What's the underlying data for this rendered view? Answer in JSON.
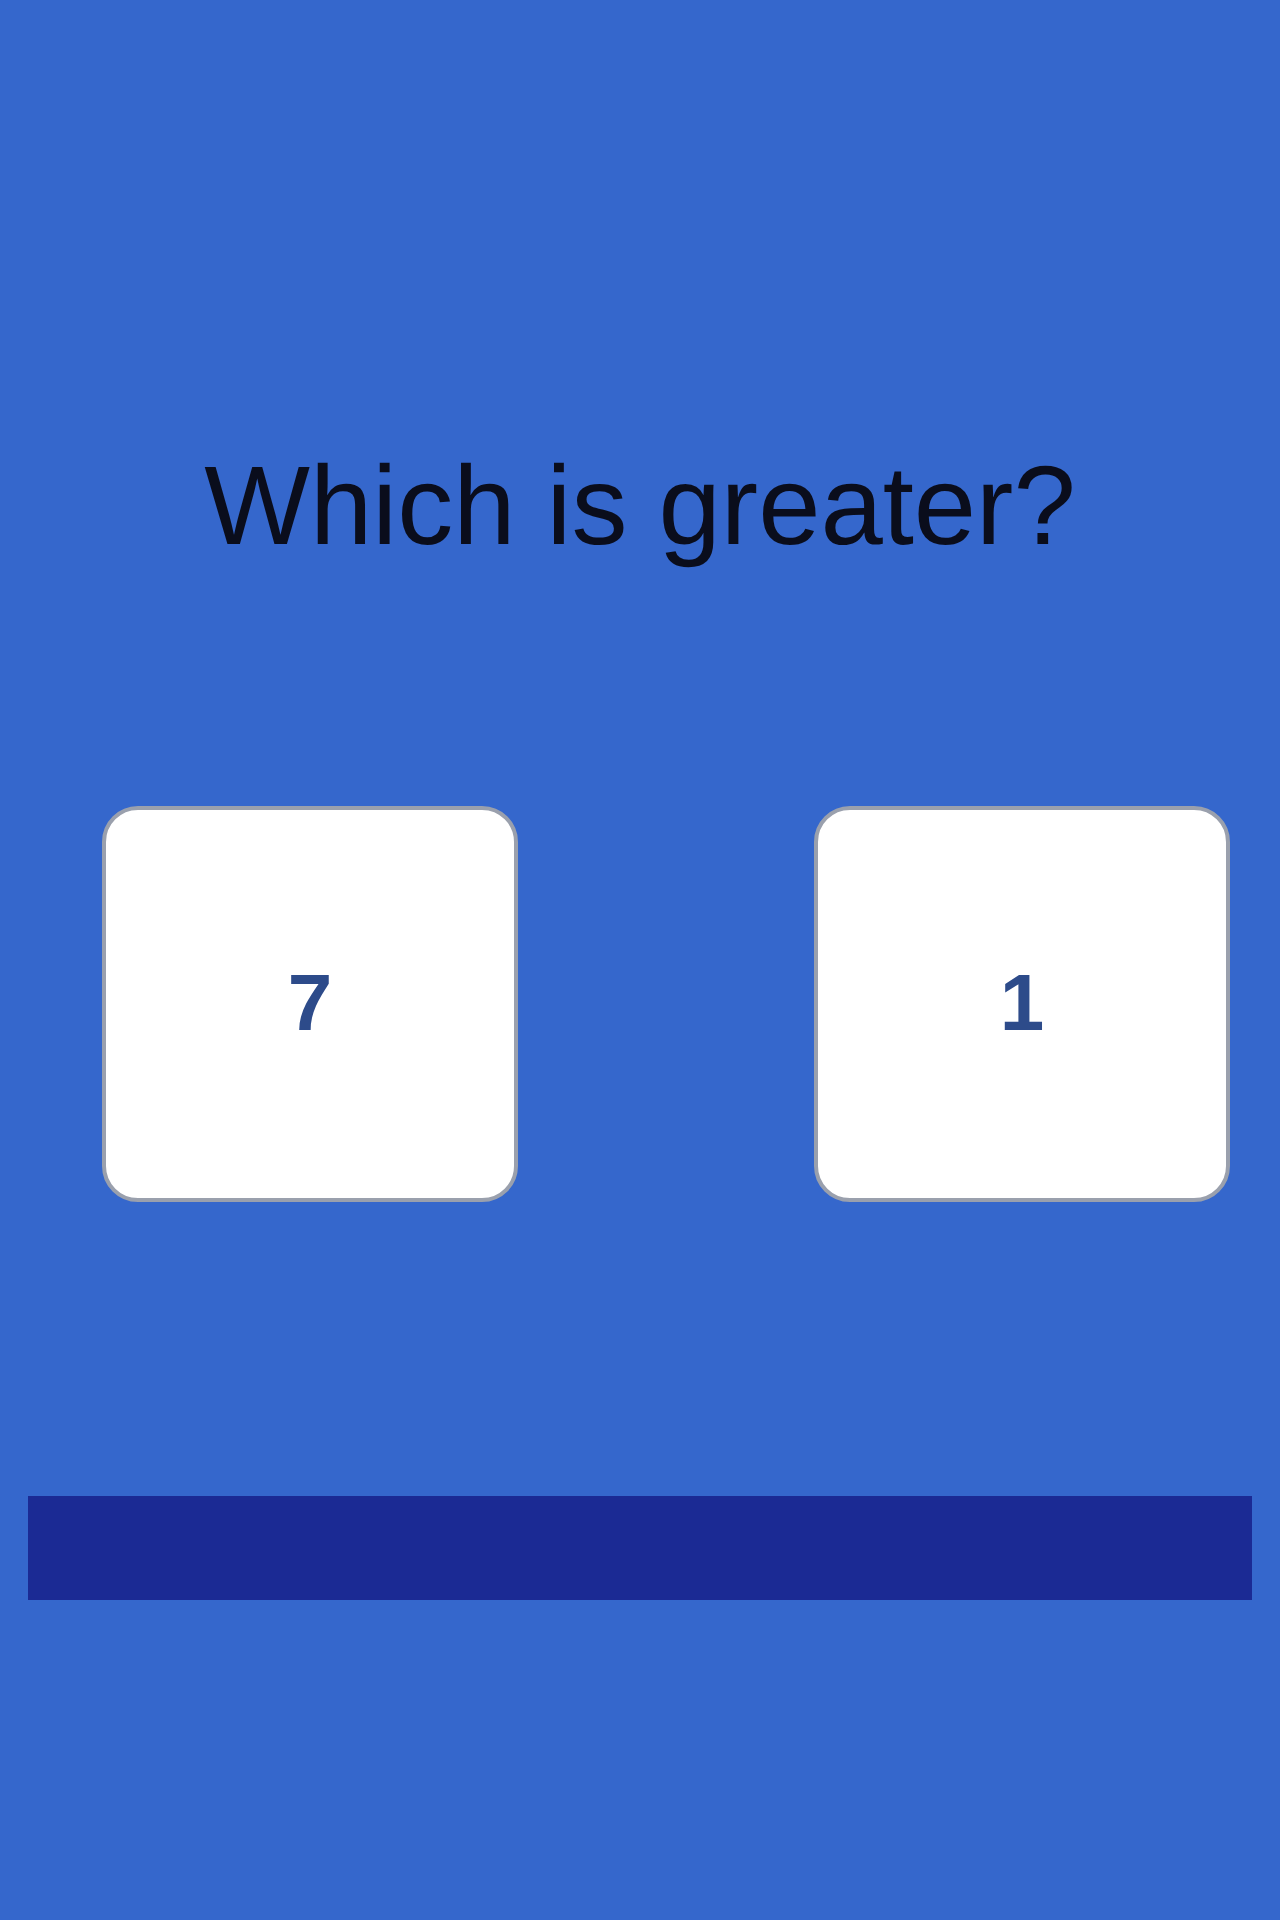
{
  "question": "Which is greater?",
  "choices": [
    {
      "label": "7"
    },
    {
      "label": "1"
    }
  ]
}
